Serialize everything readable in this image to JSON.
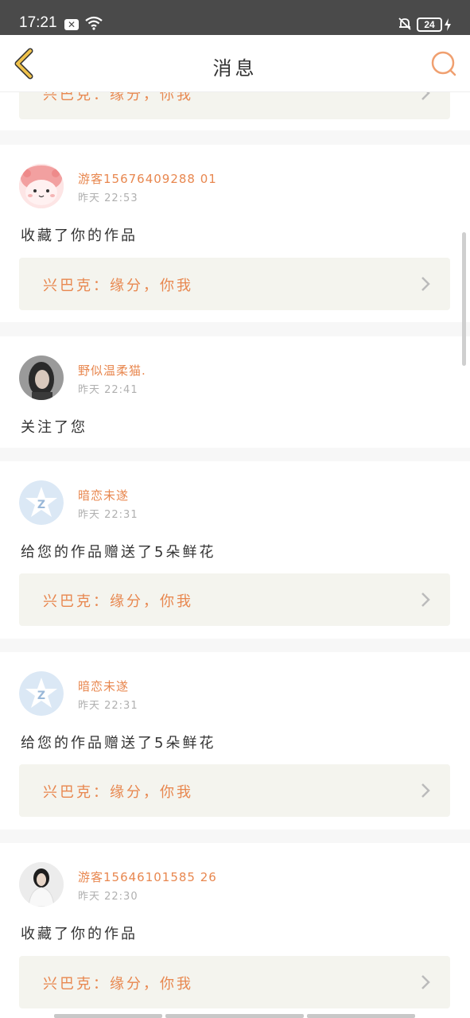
{
  "status_bar": {
    "time": "17:21",
    "x_badge": "✕",
    "battery": "24"
  },
  "header": {
    "title": "消息",
    "back_icon": "chevron-left-icon",
    "search_icon": "search-icon"
  },
  "colors": {
    "accent": "#e8874f",
    "back": "#f0c24b",
    "box_bg": "#f4f4ee"
  },
  "partial_card": {
    "work_title": "兴巴克：缘分，你我"
  },
  "messages": [
    {
      "username": "游客15676409288 01",
      "time": "昨天 22:53",
      "action": "收藏了你的作品",
      "work_title": "兴巴克：缘分，你我",
      "avatar": "pink-cartoon-avatar"
    },
    {
      "username": "野似温柔猫.",
      "time": "昨天 22:41",
      "action": "关注了您",
      "work_title": "",
      "avatar": "girl-photo-avatar"
    },
    {
      "username": "暗恋未遂",
      "time": "昨天 22:31",
      "action": "给您的作品赠送了5朵鲜花",
      "work_title": "兴巴克：缘分，你我",
      "avatar": "qq-star-avatar"
    },
    {
      "username": "暗恋未遂",
      "time": "昨天 22:31",
      "action": "给您的作品赠送了5朵鲜花",
      "work_title": "兴巴克：缘分，你我",
      "avatar": "qq-star-avatar"
    },
    {
      "username": "游客15646101585 26",
      "time": "昨天 22:30",
      "action": "收藏了你的作品",
      "work_title": "兴巴克：缘分，你我",
      "avatar": "woman-photo-avatar"
    }
  ]
}
